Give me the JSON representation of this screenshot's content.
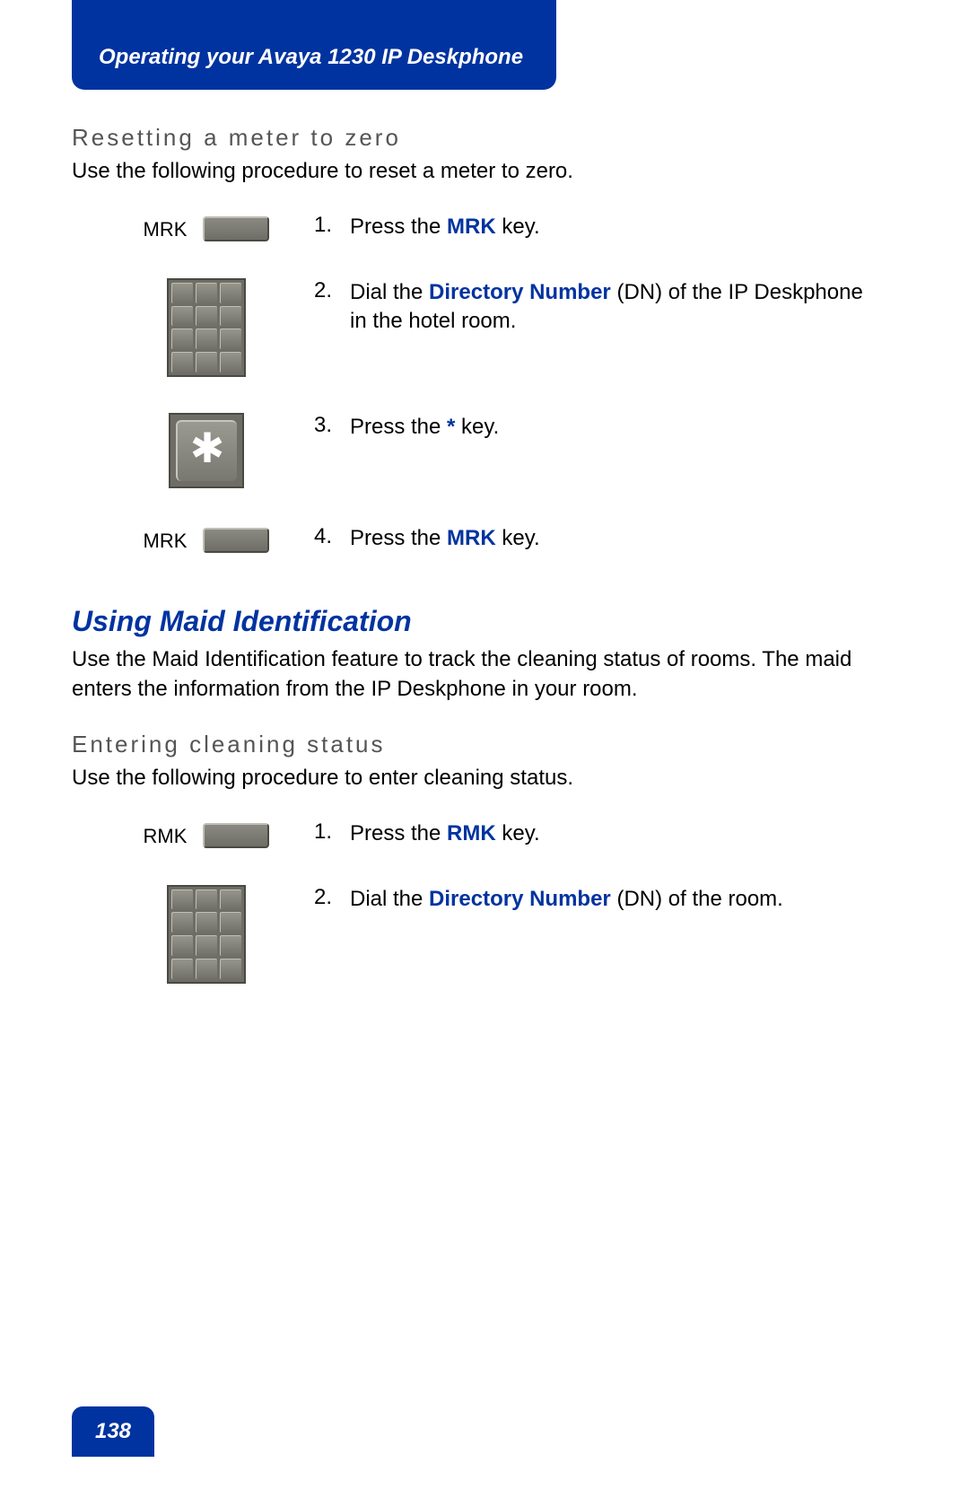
{
  "header": {
    "title": "Operating your Avaya 1230 IP Deskphone"
  },
  "section1": {
    "subheading": "Resetting a meter to zero",
    "intro": "Use the following procedure to reset a meter to zero.",
    "steps": [
      {
        "num": "1.",
        "label": "MRK",
        "pre": "Press the ",
        "hl": "MRK",
        "post": " key."
      },
      {
        "num": "2.",
        "pre": "Dial the ",
        "hl": "Directory Number",
        "post": " (DN) of the IP Deskphone in the hotel room."
      },
      {
        "num": "3.",
        "pre": "Press the ",
        "hl": "*",
        "post": " key."
      },
      {
        "num": "4.",
        "label": "MRK",
        "pre": "Press the ",
        "hl": "MRK",
        "post": " key."
      }
    ]
  },
  "section2": {
    "heading": "Using Maid Identification",
    "intro": "Use the Maid Identification feature to track the cleaning status of rooms. The maid enters the information from the IP Deskphone in your room.",
    "subheading": "Entering cleaning status",
    "intro2": "Use the following procedure to enter cleaning status.",
    "steps": [
      {
        "num": "1.",
        "label": "RMK",
        "pre": "Press the ",
        "hl": "RMK",
        "post": " key."
      },
      {
        "num": "2.",
        "pre": "Dial the ",
        "hl": "Directory Number",
        "post": " (DN) of the room."
      }
    ]
  },
  "page_number": "138"
}
